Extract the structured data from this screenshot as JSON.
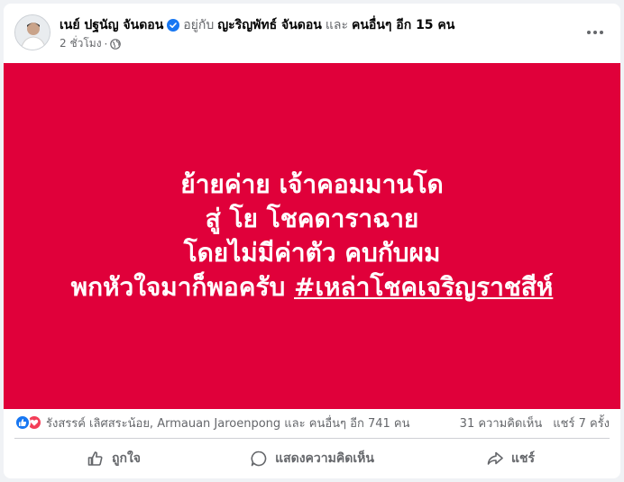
{
  "post": {
    "author": "เนย์ ปฐนัญ จันดอน",
    "with_text": "อยู่กับ",
    "tagged": "ญะริญพัทธ์ จันดอน",
    "and_text": "และ",
    "others": "คนอื่นๆ อีก 15 คน",
    "time": "2 ชั่วโมง",
    "separator": "·"
  },
  "banner": {
    "background": "#e0003a",
    "line1": "ย้ายค่าย เจ้าคอมมานโด",
    "line2": "สู่ โย โชคดาราฉาย",
    "line3": "โดยไม่มีค่าตัว คบกับผม",
    "line4_text": "พกหัวใจมาก็พอครับ ",
    "line4_hashtag": "#เหล่าโชคเจริญราชสีห์"
  },
  "reactions": {
    "names": "รังสรรค์ เลิศสระน้อย, Armauan Jaroenpong และ คนอื่นๆ อีก 741 คน",
    "comments": "31 ความคิดเห็น",
    "shares": "แชร์ 7 ครั้ง",
    "icons": [
      "like-icon",
      "love-icon"
    ]
  },
  "actions": {
    "like": "ถูกใจ",
    "comment": "แสดงความคิดเห็น",
    "share": "แชร์"
  }
}
